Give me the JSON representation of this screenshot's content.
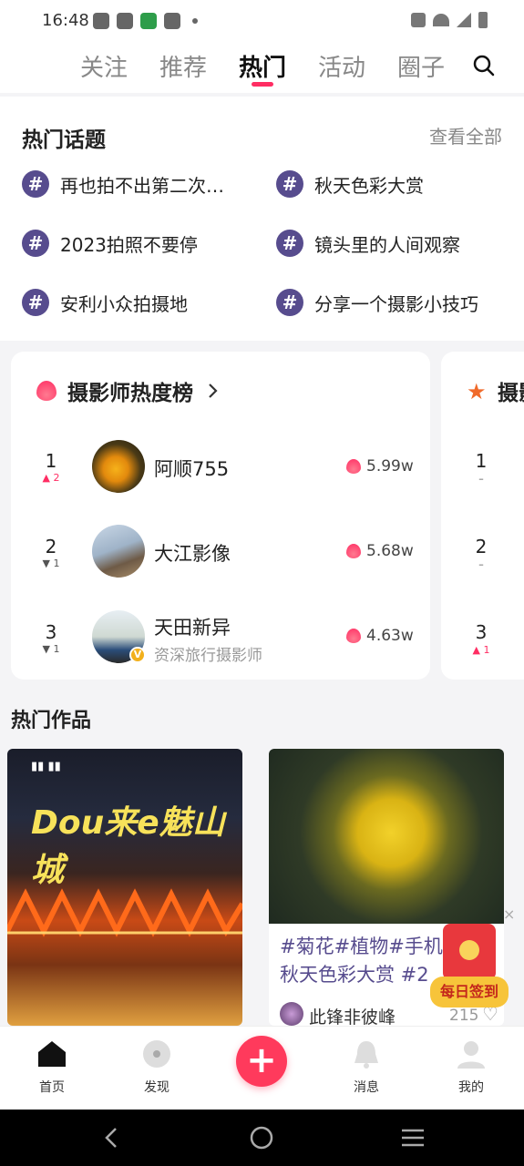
{
  "status": {
    "time": "16:48"
  },
  "tabs": [
    "关注",
    "推荐",
    "热门",
    "活动",
    "圈子"
  ],
  "active_tab": "热门",
  "topics": {
    "title": "热门话题",
    "more": "查看全部",
    "items": [
      "再也拍不出第二次…",
      "秋天色彩大赏",
      "2023拍照不要停",
      "镜头里的人间观察",
      "安利小众拍摄地",
      "分享一个摄影小技巧"
    ]
  },
  "ranking": {
    "title": "摄影师热度榜",
    "second_title_partial": "摄影",
    "entries": [
      {
        "rank": "1",
        "delta": "2",
        "delta_dir": "up",
        "name": "阿顺755",
        "score": "5.99w"
      },
      {
        "rank": "2",
        "delta": "1",
        "delta_dir": "down",
        "name": "大江影像",
        "score": "5.68w"
      },
      {
        "rank": "3",
        "delta": "1",
        "delta_dir": "down",
        "name": "天田新异",
        "subtitle": "资深旅行摄影师",
        "score": "4.63w"
      }
    ],
    "second_ranks": [
      "1",
      "2",
      "3"
    ],
    "second_deltas": [
      "–",
      "–",
      "1"
    ]
  },
  "works": {
    "title": "热门作品",
    "card1_poster": "Dou来e魅山城",
    "card2_text": "#菊花#植物#手机摄影#秋天色彩大赏 #2",
    "card2_user": "此锋非彼峰",
    "card2_likes": "215"
  },
  "floating": {
    "label": "每日签到"
  },
  "bottom_nav": [
    "首页",
    "发现",
    "消息",
    "我的"
  ],
  "colors": {
    "accent": "#ff2d63",
    "topic": "#574c8e"
  }
}
